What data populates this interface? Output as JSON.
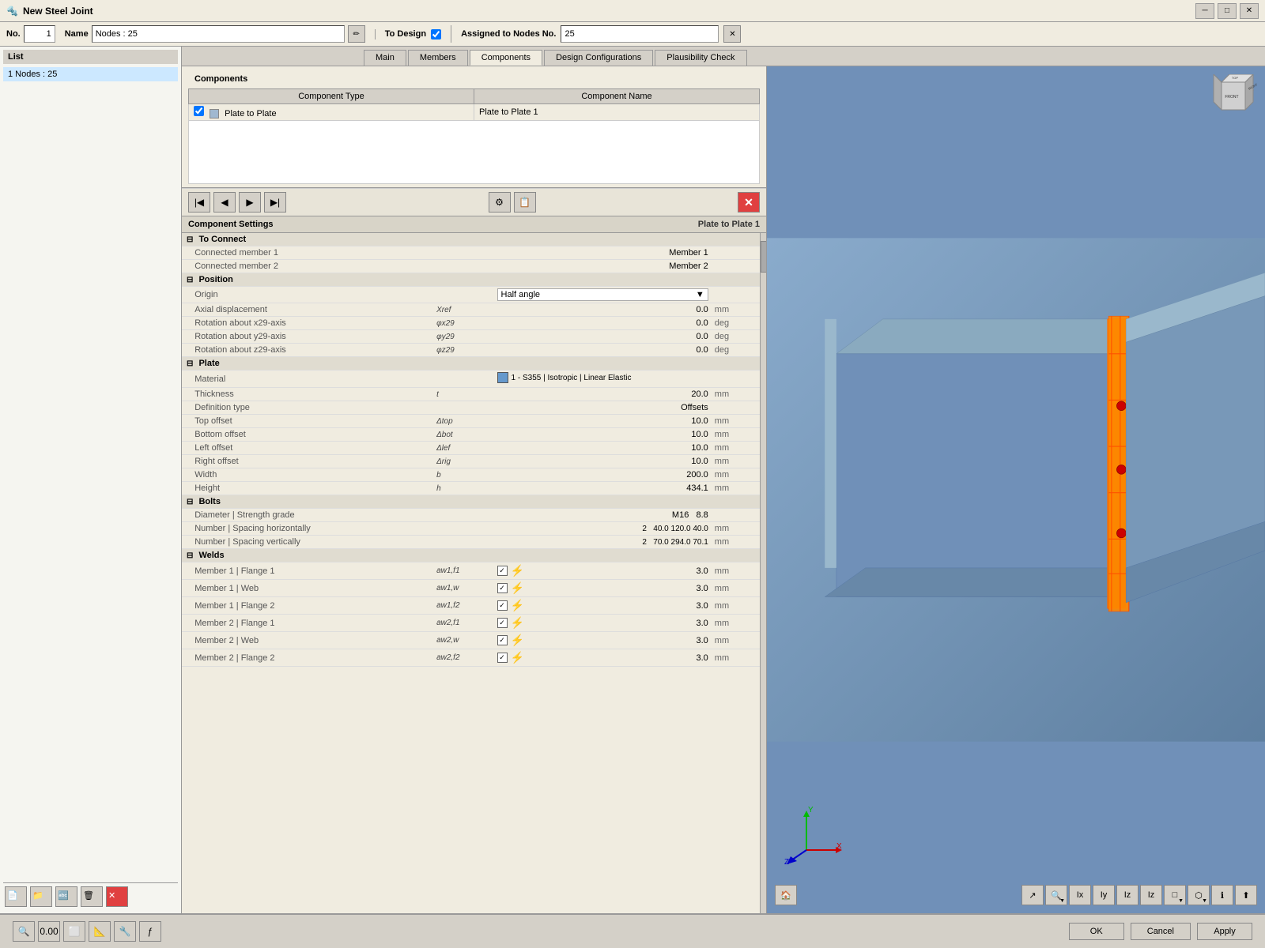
{
  "titleBar": {
    "title": "New Steel Joint",
    "icon": "🔩"
  },
  "topForm": {
    "noLabel": "No.",
    "noValue": "1",
    "nameLabel": "Name",
    "nameValue": "Nodes : 25",
    "toDesignLabel": "To Design",
    "assignedLabel": "Assigned to Nodes No.",
    "assignedValue": "25"
  },
  "tabs": [
    {
      "id": "main",
      "label": "Main"
    },
    {
      "id": "members",
      "label": "Members"
    },
    {
      "id": "components",
      "label": "Components"
    },
    {
      "id": "design-config",
      "label": "Design Configurations"
    },
    {
      "id": "plausibility",
      "label": "Plausibility Check"
    }
  ],
  "sidebar": {
    "header": "List",
    "items": [
      {
        "label": "1  Nodes : 25"
      }
    ],
    "buttons": [
      "⬅",
      "↗",
      "🖊",
      "🗑"
    ]
  },
  "components": {
    "sectionLabel": "Components",
    "columns": [
      "Component Type",
      "Component Name"
    ],
    "rows": [
      {
        "checked": true,
        "type": "Plate to Plate",
        "name": "Plate to Plate 1"
      }
    ]
  },
  "toolbar": {
    "buttons": [
      "◀◀",
      "◀",
      "▶",
      "▶▶",
      "⚙",
      "📋"
    ],
    "deleteBtn": "✕"
  },
  "settings": {
    "headerLeft": "Component Settings",
    "headerRight": "Plate to Plate 1",
    "sections": {
      "toConnect": {
        "label": "To Connect",
        "fields": [
          {
            "name": "Connected member 1",
            "symbol": "",
            "value": "Member 1",
            "unit": ""
          },
          {
            "name": "Connected member 2",
            "symbol": "",
            "value": "Member 2",
            "unit": ""
          }
        ]
      },
      "position": {
        "label": "Position",
        "fields": [
          {
            "name": "Origin",
            "symbol": "",
            "value": "Half angle",
            "unit": "",
            "isDropdown": true
          },
          {
            "name": "Axial displacement",
            "symbol": "Xref",
            "value": "0.0",
            "unit": "mm"
          },
          {
            "name": "Rotation about x29-axis",
            "symbol": "φx29",
            "value": "0.0",
            "unit": "deg"
          },
          {
            "name": "Rotation about y29-axis",
            "symbol": "φy29",
            "value": "0.0",
            "unit": "deg"
          },
          {
            "name": "Rotation about z29-axis",
            "symbol": "φz29",
            "value": "0.0",
            "unit": "deg"
          }
        ]
      },
      "plate": {
        "label": "Plate",
        "fields": [
          {
            "name": "Material",
            "symbol": "",
            "value": "1 - S355 | Isotropic | Linear Elastic",
            "unit": "",
            "isMaterial": true
          },
          {
            "name": "Thickness",
            "symbol": "t",
            "value": "20.0",
            "unit": "mm"
          },
          {
            "name": "Definition type",
            "symbol": "",
            "value": "Offsets",
            "unit": ""
          },
          {
            "name": "Top offset",
            "symbol": "Δtop",
            "value": "10.0",
            "unit": "mm"
          },
          {
            "name": "Bottom offset",
            "symbol": "Δbot",
            "value": "10.0",
            "unit": "mm"
          },
          {
            "name": "Left offset",
            "symbol": "Δlef",
            "value": "10.0",
            "unit": "mm"
          },
          {
            "name": "Right offset",
            "symbol": "Δrig",
            "value": "10.0",
            "unit": "mm"
          },
          {
            "name": "Width",
            "symbol": "b",
            "value": "200.0",
            "unit": "mm"
          },
          {
            "name": "Height",
            "symbol": "h",
            "value": "434.1",
            "unit": "mm"
          }
        ]
      },
      "bolts": {
        "label": "Bolts",
        "fields": [
          {
            "name": "Diameter | Strength grade",
            "symbol": "",
            "value": "M16   8.8",
            "unit": ""
          },
          {
            "name": "Number | Spacing horizontally",
            "symbol": "",
            "value": "2     40.0  120.0  40.0",
            "unit": "mm"
          },
          {
            "name": "Number | Spacing vertically",
            "symbol": "",
            "value": "2     70.0  294.0  70.1",
            "unit": "mm"
          }
        ]
      },
      "welds": {
        "label": "Welds",
        "fields": [
          {
            "name": "Member 1 | Flange 1",
            "symbol": "aw1,f1",
            "value": "3.0",
            "unit": "mm"
          },
          {
            "name": "Member 1 | Web",
            "symbol": "aw1,w",
            "value": "3.0",
            "unit": "mm"
          },
          {
            "name": "Member 1 | Flange 2",
            "symbol": "aw1,f2",
            "value": "3.0",
            "unit": "mm"
          },
          {
            "name": "Member 2 | Flange 1",
            "symbol": "aw2,f1",
            "value": "3.0",
            "unit": "mm"
          },
          {
            "name": "Member 2 | Web",
            "symbol": "aw2,w",
            "value": "3.0",
            "unit": "mm"
          },
          {
            "name": "Member 2 | Flange 2",
            "symbol": "aw2,f2",
            "value": "3.0",
            "unit": "mm"
          }
        ]
      }
    }
  },
  "bottomBar": {
    "leftButtons": [
      "🔍",
      "0.00",
      "⬜",
      "📐",
      "🔧",
      "ƒ"
    ],
    "okLabel": "OK",
    "cancelLabel": "Cancel",
    "applyLabel": "Apply"
  }
}
